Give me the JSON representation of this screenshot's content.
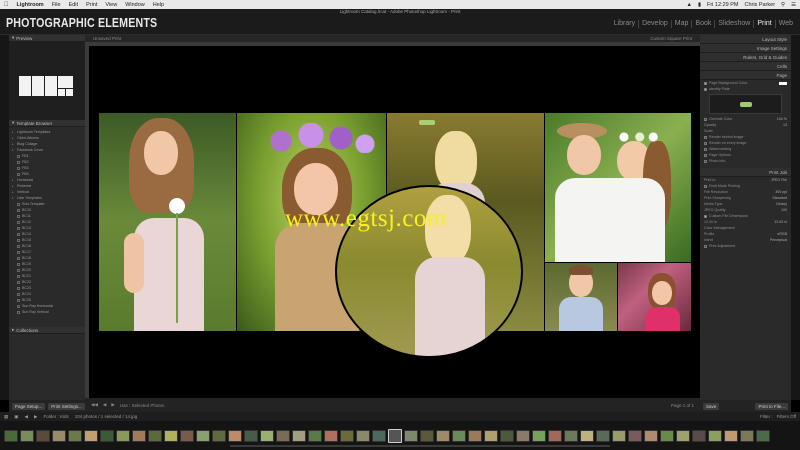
{
  "menubar": {
    "app": "Lightroom",
    "items": [
      "File",
      "Edit",
      "Print",
      "View",
      "Window",
      "Help"
    ],
    "battery": "(charged)",
    "clock": "Fri 12:29 PM",
    "user": "Chris Parker"
  },
  "header": {
    "brand": "PHOTOGRAPHIC ELEMENTS",
    "window_title": "Lightroom Catalog.lrcat - Adobe Photoshop Lightroom - Print",
    "modules": [
      "Library",
      "Develop",
      "Map",
      "Book",
      "Slideshow",
      "Print",
      "Web"
    ],
    "active_module": "Print"
  },
  "left": {
    "preview_label": "Preview",
    "template_browser_label": "Template Browser",
    "templates": [
      "Lightroom Templates",
      "Client Albums",
      "Blog Collage",
      "Facebook Cover",
      "FB1",
      "FB2",
      "FB3",
      "FB4",
      "Horizontal",
      "Pinterest",
      "Vertical",
      "User Templates",
      "Kids Template",
      "BC10",
      "BC11",
      "BC12",
      "BC13",
      "BC14",
      "BC15",
      "BC16",
      "BC17",
      "BC18",
      "BC19",
      "BC20",
      "BC21",
      "BC22",
      "BC23",
      "BC24",
      "BC25",
      "Sun Ray Horizontal",
      "Sun Ray Vertical"
    ],
    "collections_label": "Collections",
    "page_setup": "Page Setup...",
    "print_settings": "Print Settings..."
  },
  "center": {
    "title": "Unsaved Print",
    "subtitle": "Custom Square Print",
    "use_label": "Use : Selected Photos",
    "page_label": "Page 1 of 1",
    "watermark": "www.egtsj.com"
  },
  "right": {
    "sections": [
      "Layout Style",
      "Image Settings",
      "Rulers, Grid & Guides",
      "Cells",
      "Page"
    ],
    "page_rows": [
      {
        "label": "Page Background Color",
        "checked": true
      },
      {
        "label": "Identity Plate",
        "checked": true
      },
      {
        "label": "Override Color",
        "checked": false,
        "value": "100 %"
      },
      {
        "label": "Opacity",
        "value": "13"
      },
      {
        "label": "Scale",
        "value": ""
      },
      {
        "label": "Render behind image",
        "checked": false
      },
      {
        "label": "Render on every image",
        "checked": false
      },
      {
        "label": "Watermarking",
        "checked": false
      },
      {
        "label": "Page Options",
        "checked": false
      },
      {
        "label": "Photo Info",
        "checked": false
      }
    ],
    "print_job_label": "Print Job",
    "print_rows": [
      {
        "label": "Print to",
        "value": "JPEG File"
      },
      {
        "label": "Draft Mode Printing",
        "checked": false
      },
      {
        "label": "File Resolution",
        "value": "300 ppi"
      },
      {
        "label": "Print Sharpening",
        "value": "Standard"
      },
      {
        "label": "Media Type",
        "value": "Glossy"
      },
      {
        "label": "JPEG Quality",
        "value": "100"
      },
      {
        "label": "Custom File Dimensions",
        "checked": true
      },
      {
        "label": "12.00 in",
        "value": "12.00 in"
      },
      {
        "label": "Color Management",
        "value": ""
      },
      {
        "label": "Profile",
        "value": "sRGB"
      },
      {
        "label": "Intent",
        "value": "Perceptual"
      },
      {
        "label": "Print Adjustment",
        "checked": false
      }
    ],
    "save_label": "Save",
    "print_to_file": "Print to File..."
  },
  "filmstrip": {
    "folder": "Folder : Kids",
    "count": "104 photos / 1 selected / 14.jpg",
    "filter_label": "Filter :",
    "filter_value": "Filters Off",
    "thumb_colors": [
      "#4a6a3a",
      "#7a8c5a",
      "#5a4a3a",
      "#9a8a6a",
      "#6a7a4a",
      "#c0a070",
      "#3a5a3a",
      "#8a9a5a",
      "#a07a5a",
      "#5a6a3a",
      "#b0b060",
      "#7a5a4a",
      "#8aa070",
      "#606a40",
      "#c08a6a",
      "#4a5a4a",
      "#9ab070",
      "#7a6a5a",
      "#a0a080",
      "#5a7a4a",
      "#b07060",
      "#6a6a3a",
      "#8a8a6a",
      "#4a6a5a",
      "#c0a080",
      "#7a8a6a",
      "#5a5a3a",
      "#a08a6a",
      "#6a8a5a",
      "#9a7a5a",
      "#b0a070",
      "#4a5a3a",
      "#8a7a6a",
      "#7aa060",
      "#a06a5a",
      "#6a7a5a",
      "#c0b080",
      "#5a6a5a",
      "#9a9a6a",
      "#7a5a5a",
      "#b08a70",
      "#6a8a4a",
      "#a0a070",
      "#5a4a4a",
      "#8aa060",
      "#c09a70",
      "#7a7a5a",
      "#4a6a4a"
    ]
  }
}
